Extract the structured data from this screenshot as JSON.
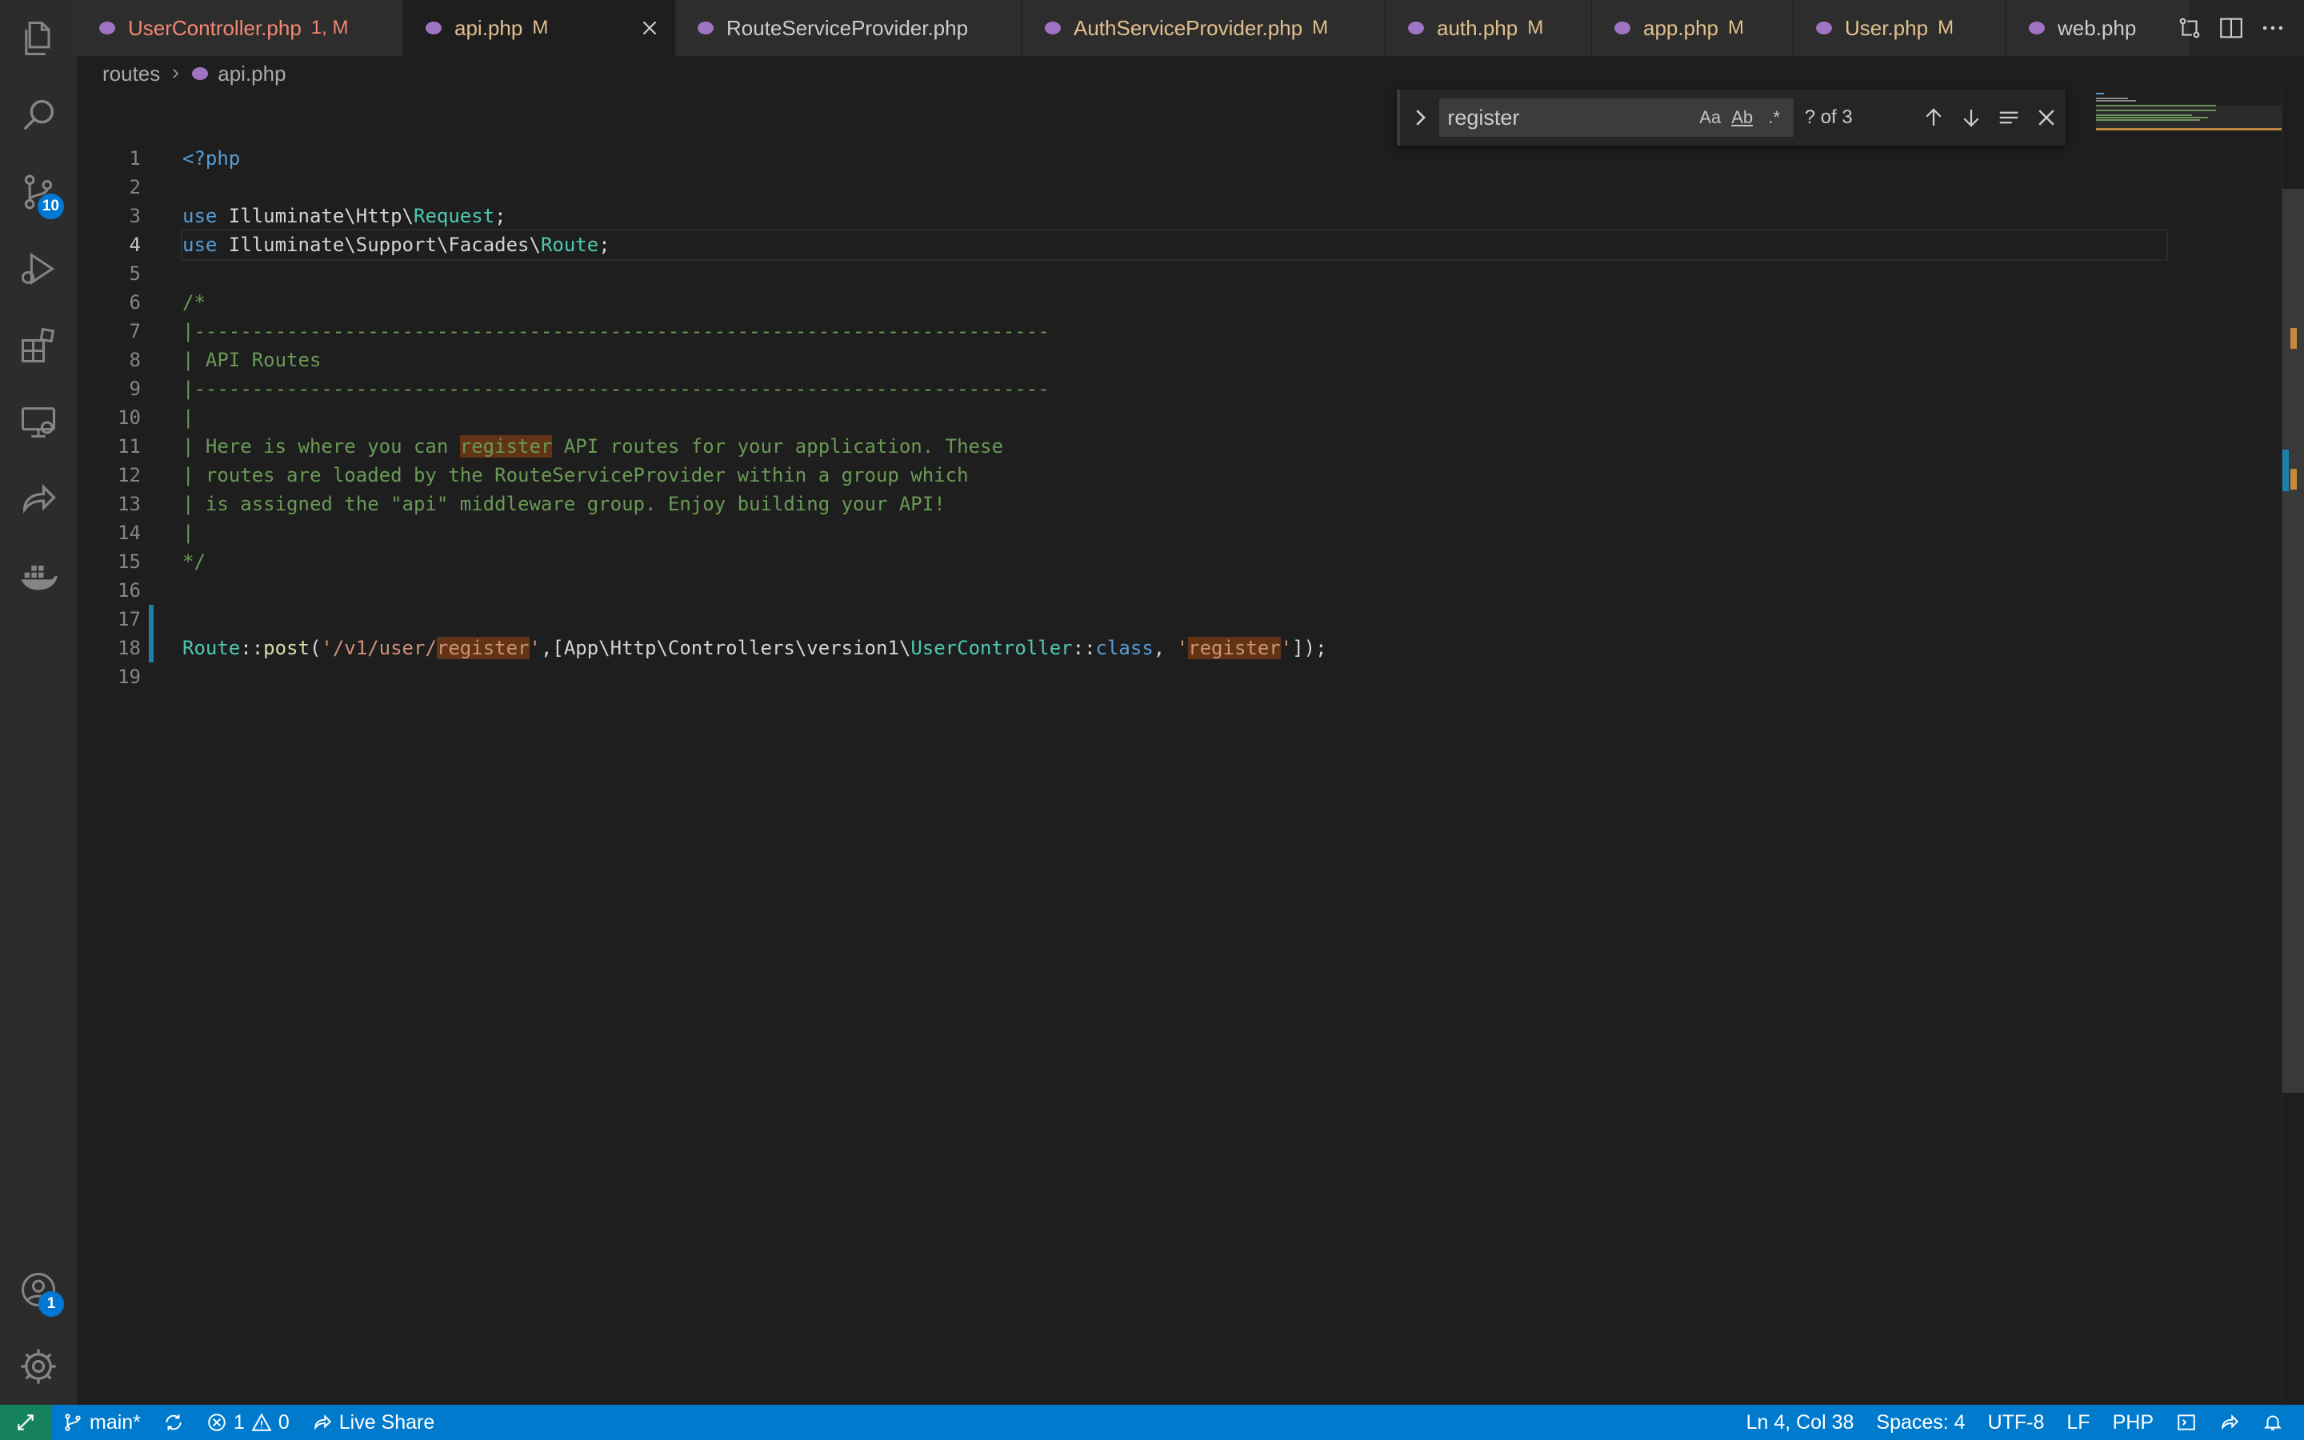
{
  "activity_bar": {
    "items": [
      {
        "name": "explorer"
      },
      {
        "name": "search"
      },
      {
        "name": "source-control",
        "badge": "10"
      },
      {
        "name": "run-debug"
      },
      {
        "name": "extensions"
      },
      {
        "name": "remote-explorer"
      },
      {
        "name": "live-share"
      },
      {
        "name": "docker"
      }
    ],
    "accounts_badge": "1"
  },
  "tabs": [
    {
      "name": "UserController.php",
      "status": "1, M",
      "state": "error"
    },
    {
      "name": "api.php",
      "status": "M",
      "state": "active"
    },
    {
      "name": "RouteServiceProvider.php",
      "status": "",
      "state": "plain"
    },
    {
      "name": "AuthServiceProvider.php",
      "status": "M",
      "state": "modified"
    },
    {
      "name": "auth.php",
      "status": "M",
      "state": "modified"
    },
    {
      "name": "app.php",
      "status": "M",
      "state": "modified"
    },
    {
      "name": "User.php",
      "status": "M",
      "state": "modified"
    },
    {
      "name": "web.php",
      "status": "",
      "state": "plain"
    }
  ],
  "breadcrumb": {
    "folder": "routes",
    "file": "api.php"
  },
  "find": {
    "query": "register",
    "count": "? of 3",
    "case_label": "Aa",
    "word_label": "Ab",
    "regex_label": ".*"
  },
  "editor": {
    "current_line": 4,
    "line_numbers": [
      "1",
      "2",
      "3",
      "4",
      "5",
      "6",
      "7",
      "8",
      "9",
      "10",
      "11",
      "12",
      "13",
      "14",
      "15",
      "16",
      "17",
      "18",
      "19"
    ]
  },
  "status_bar": {
    "branch": "main*",
    "errors": "1",
    "warnings": "0",
    "live_share": "Live Share",
    "position": "Ln 4, Col 38",
    "spaces": "Spaces: 4",
    "encoding": "UTF-8",
    "eol": "LF",
    "language": "PHP"
  },
  "colors": {
    "accent": "#007acc",
    "match": "#623315",
    "modified_tab": "#e2c08d",
    "error_tab": "#f48771"
  }
}
